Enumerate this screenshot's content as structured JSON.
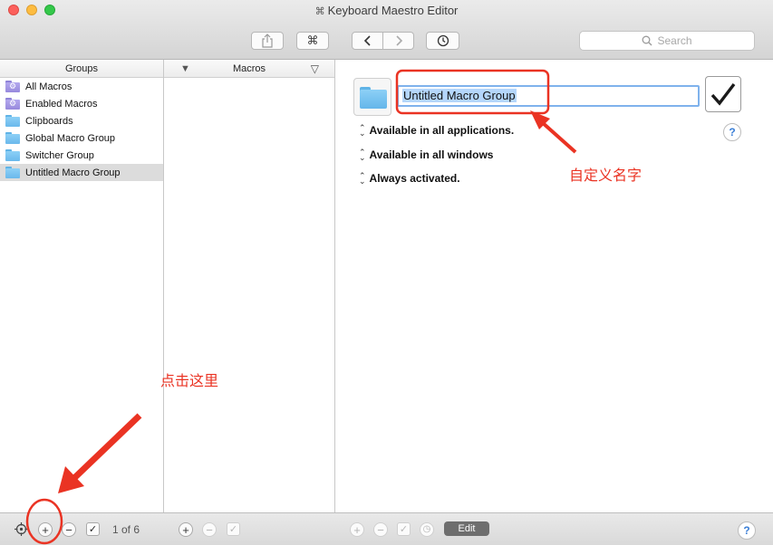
{
  "window": {
    "title": "Keyboard Maestro Editor",
    "title_glyph": "⌘"
  },
  "toolbar": {
    "share_icon": "share-icon",
    "cmd_label": "⌘",
    "back_label": "‹",
    "forward_label": "›",
    "search_placeholder": "Search"
  },
  "groups": {
    "header": "Groups",
    "items": [
      {
        "label": "All Macros",
        "icon": "smart-folder-icon",
        "selected": false
      },
      {
        "label": "Enabled Macros",
        "icon": "smart-folder-icon",
        "selected": false
      },
      {
        "label": "Clipboards",
        "icon": "folder-icon",
        "selected": false
      },
      {
        "label": "Global Macro Group",
        "icon": "folder-icon",
        "selected": false
      },
      {
        "label": "Switcher Group",
        "icon": "folder-icon",
        "selected": false
      },
      {
        "label": "Untitled Macro Group",
        "icon": "folder-icon",
        "selected": true
      }
    ]
  },
  "macros": {
    "header": "Macros"
  },
  "detail": {
    "group_name": "Untitled Macro Group",
    "enabled": true,
    "availability_apps": "Available in all applications.",
    "availability_windows": "Available in all windows",
    "activation": "Always activated."
  },
  "bottom": {
    "count_text": "1 of 6",
    "edit_label": "Edit",
    "help_label": "?"
  },
  "annotations": {
    "rename_note": "自定义名字",
    "click_note": "点击这里",
    "color": "#ea3323"
  }
}
